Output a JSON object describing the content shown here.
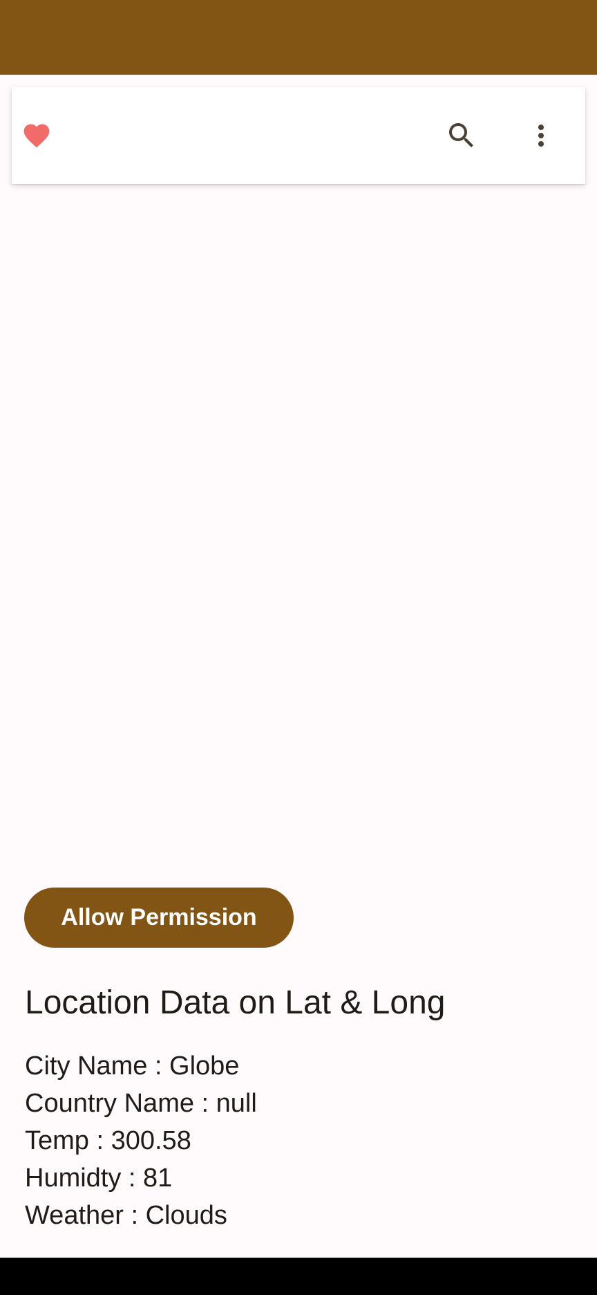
{
  "colors": {
    "primary": "#825515",
    "background": "#FFFAFC",
    "favorite": "#F26B6B",
    "icon": "#4a4036",
    "text": "#1f1b16"
  },
  "toolbar": {
    "favorite_icon": "heart-icon",
    "search_icon": "search-icon",
    "more_icon": "more-vertical-icon"
  },
  "actions": {
    "allow_permission_label": "Allow Permission"
  },
  "location": {
    "title": "Location Data on Lat & Long",
    "city": "City Name : Globe",
    "country": "Country Name : null",
    "temp": "Temp : 300.58",
    "humidity": "Humidty : 81",
    "weather": "Weather : Clouds"
  }
}
